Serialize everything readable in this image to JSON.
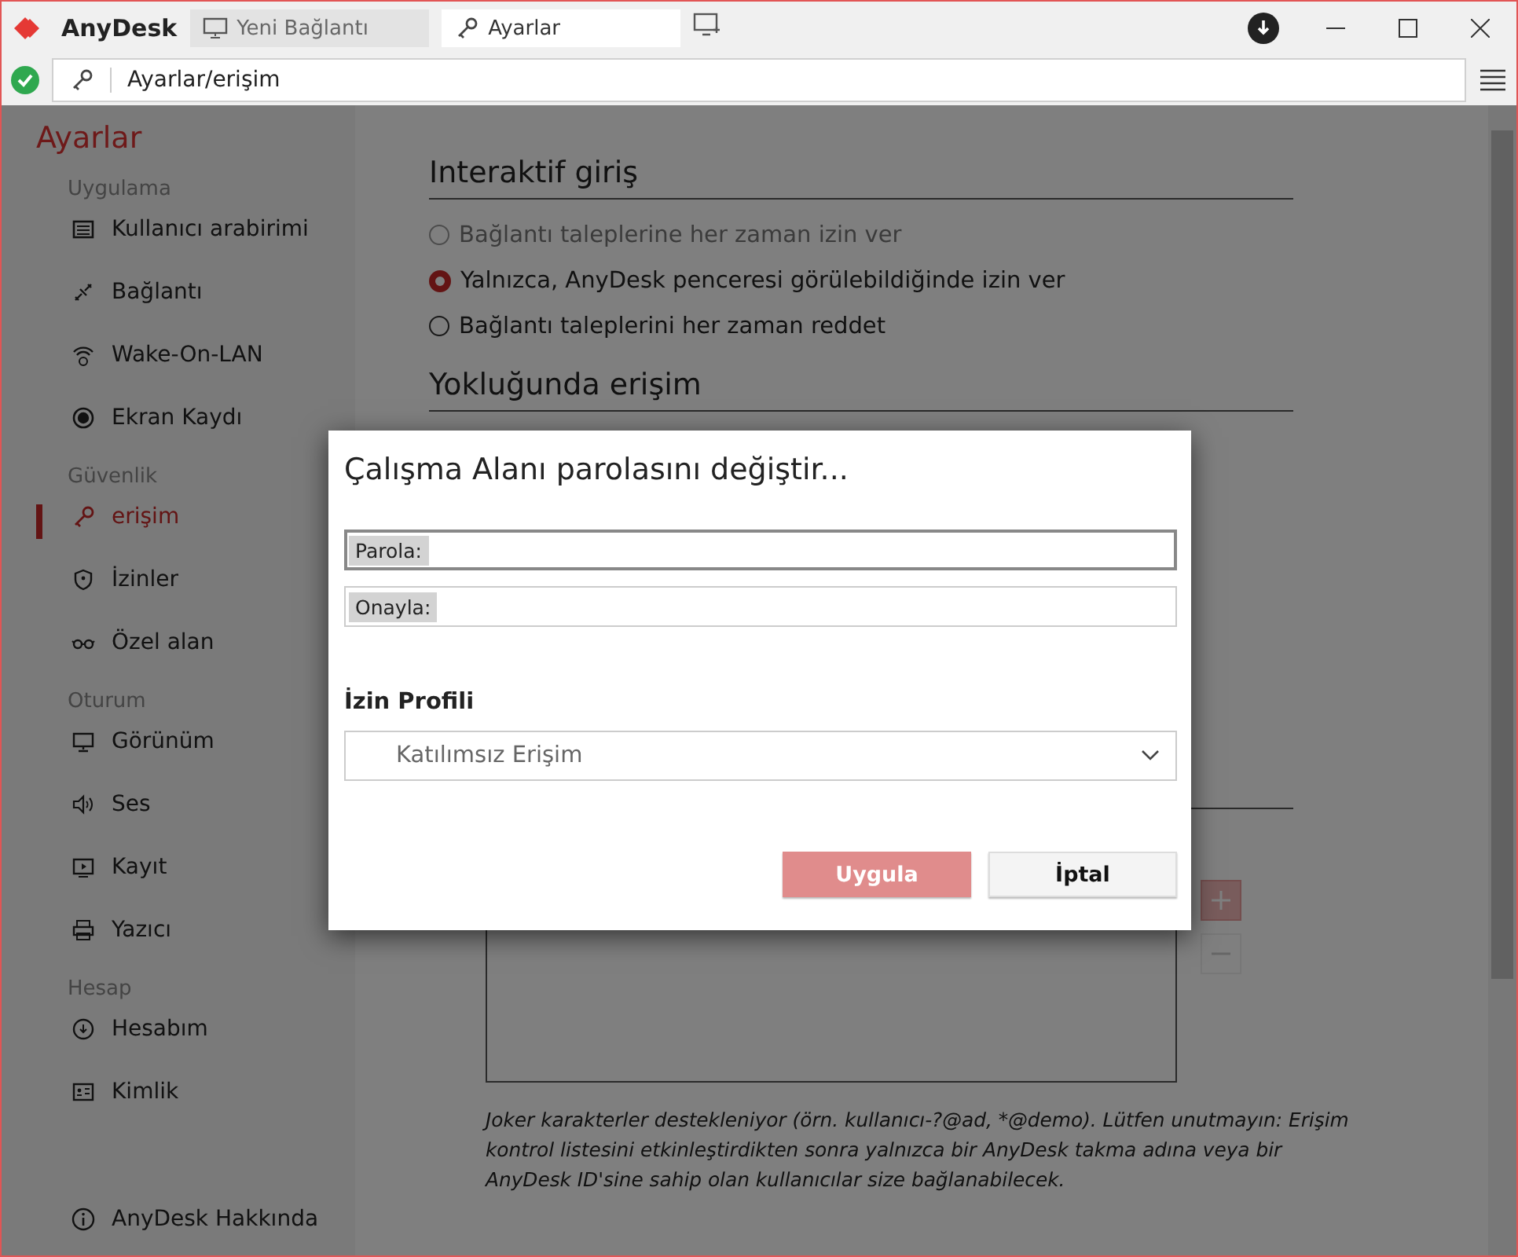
{
  "titlebar": {
    "app_name": "AnyDesk",
    "tabs": [
      {
        "label": "Yeni Bağlantı",
        "selected": false
      },
      {
        "label": "Ayarlar",
        "selected": true
      }
    ]
  },
  "address_bar": {
    "path": "Ayarlar/erişim"
  },
  "sidebar": {
    "title": "Ayarlar",
    "groups": [
      {
        "title": "Uygulama",
        "items": [
          {
            "label": "Kullanıcı arabirimi",
            "selected": false
          },
          {
            "label": "Bağlantı",
            "selected": false
          },
          {
            "label": "Wake-On-LAN",
            "selected": false
          },
          {
            "label": "Ekran Kaydı",
            "selected": false
          }
        ]
      },
      {
        "title": "Güvenlik",
        "items": [
          {
            "label": "erişim",
            "selected": true
          },
          {
            "label": "İzinler",
            "selected": false
          },
          {
            "label": "Özel alan",
            "selected": false
          }
        ]
      },
      {
        "title": "Oturum",
        "items": [
          {
            "label": "Görünüm",
            "selected": false
          },
          {
            "label": "Ses",
            "selected": false
          },
          {
            "label": "Kayıt",
            "selected": false
          },
          {
            "label": "Yazıcı",
            "selected": false
          }
        ]
      },
      {
        "title": "Hesap",
        "items": [
          {
            "label": "Hesabım",
            "selected": false
          },
          {
            "label": "Kimlik",
            "selected": false
          }
        ]
      }
    ],
    "footer_item": {
      "label": "AnyDesk Hakkında",
      "selected": false
    }
  },
  "content": {
    "sections": [
      {
        "title": "Interaktif giriş",
        "options": [
          {
            "label": "Bağlantı taleplerine her zaman izin ver",
            "selected": false,
            "disabled": true
          },
          {
            "label": "Yalnızca, AnyDesk penceresi görülebildiğinde izin ver",
            "selected": true,
            "disabled": false
          },
          {
            "label": "Bağlantı taleplerini her zaman reddet",
            "selected": false,
            "disabled": false
          }
        ]
      },
      {
        "title": "Yokluğunda erişim"
      }
    ],
    "note": "Joker karakterler destekleniyor (örn. kullanıcı-?@ad, *@demo). Lütfen unutmayın: Erişim kontrol listesini etkinleştirdikten sonra yalnızca bir AnyDesk takma adına veya bir AnyDesk ID'sine sahip olan kullanıcılar size bağlanabilecek."
  },
  "dialog": {
    "title": "Çalışma Alanı parolasını değiştir...",
    "fields": [
      {
        "label": "Parola:",
        "focused": true
      },
      {
        "label": "Onayla:",
        "focused": false
      }
    ],
    "profile_label": "İzin Profili",
    "profile_value": "Katılımsız Erişim",
    "buttons": [
      {
        "label": "Uygula",
        "disabled": true
      },
      {
        "label": "İptal",
        "disabled": false
      }
    ]
  }
}
